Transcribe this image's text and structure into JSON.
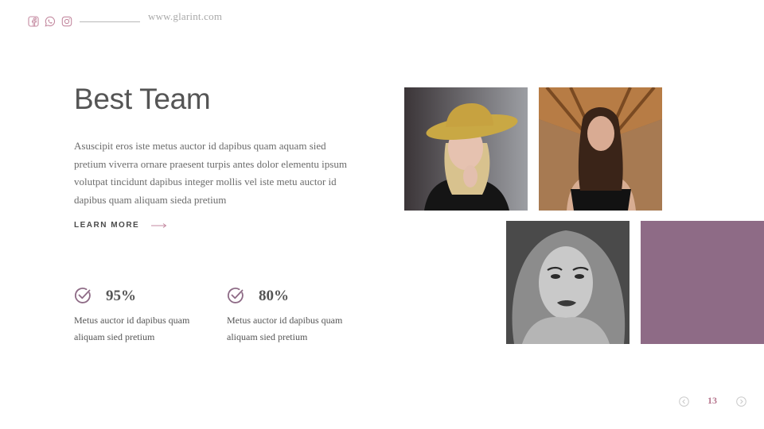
{
  "header": {
    "website": "www.glarint.com",
    "social_icons": [
      "facebook-icon",
      "whatsapp-icon",
      "instagram-icon"
    ]
  },
  "main": {
    "title": "Best Team",
    "description": "Asuscipit eros iste metus auctor id dapibus quam aquam sied pretium viverra ornare praesent turpis antes dolor elementu ipsum volutpat tincidunt dapibus integer mollis vel iste metu auctor id dapibus quam aliquam sieda pretium",
    "learn_more_label": "LEARN MORE"
  },
  "stats": [
    {
      "value": "95%",
      "text": "Metus auctor id dapibus quam aliquam sied pretium"
    },
    {
      "value": "80%",
      "text": "Metus auctor id dapibus quam aliquam sied pretium"
    }
  ],
  "pagination": {
    "page": "13"
  },
  "colors": {
    "accent": "#b7778f",
    "block": "#8e6b86",
    "text": "#555555"
  }
}
